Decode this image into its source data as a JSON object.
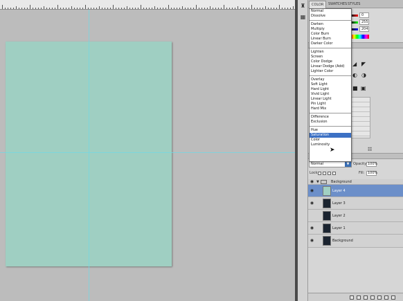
{
  "panel_tabs": [
    "COLOR",
    "SWATCHES",
    "STYLES"
  ],
  "color_values": [
    "0",
    "255",
    "204"
  ],
  "blend_menu": {
    "groups": [
      [
        "Normal",
        "Dissolve"
      ],
      [
        "Darken",
        "Multiply",
        "Color Burn",
        "Linear Burn",
        "Darker Color"
      ],
      [
        "Lighten",
        "Screen",
        "Color Dodge",
        "Linear Dodge (Add)",
        "Lighter Color"
      ],
      [
        "Overlay",
        "Soft Light",
        "Hard Light",
        "Vivid Light",
        "Linear Light",
        "Pin Light",
        "Hard Mix"
      ],
      [
        "Difference",
        "Exclusion"
      ],
      [
        "Hue",
        "Saturation",
        "Color",
        "Luminosity"
      ]
    ],
    "highlighted": "Saturation"
  },
  "layers": {
    "blend_mode": "Normal",
    "opacity_label": "Opacity:",
    "opacity_value": "100%",
    "lock_label": "Lock:",
    "fill_label": "Fill:",
    "fill_value": "100%",
    "group_name": "Background",
    "rows": [
      {
        "name": "Layer 4",
        "selected": true,
        "thumb": "teal"
      },
      {
        "name": "Layer 3",
        "selected": false,
        "thumb": "dark"
      },
      {
        "name": "Layer 2",
        "selected": false,
        "thumb": "dark"
      },
      {
        "name": "Layer 1",
        "selected": false,
        "thumb": "dark"
      },
      {
        "name": "Background",
        "selected": false,
        "thumb": "dark"
      }
    ]
  },
  "colors": {
    "canvas_fill": "#9fcfc2",
    "highlight": "#3d71c4",
    "selected_layer": "#6c8fc9"
  }
}
